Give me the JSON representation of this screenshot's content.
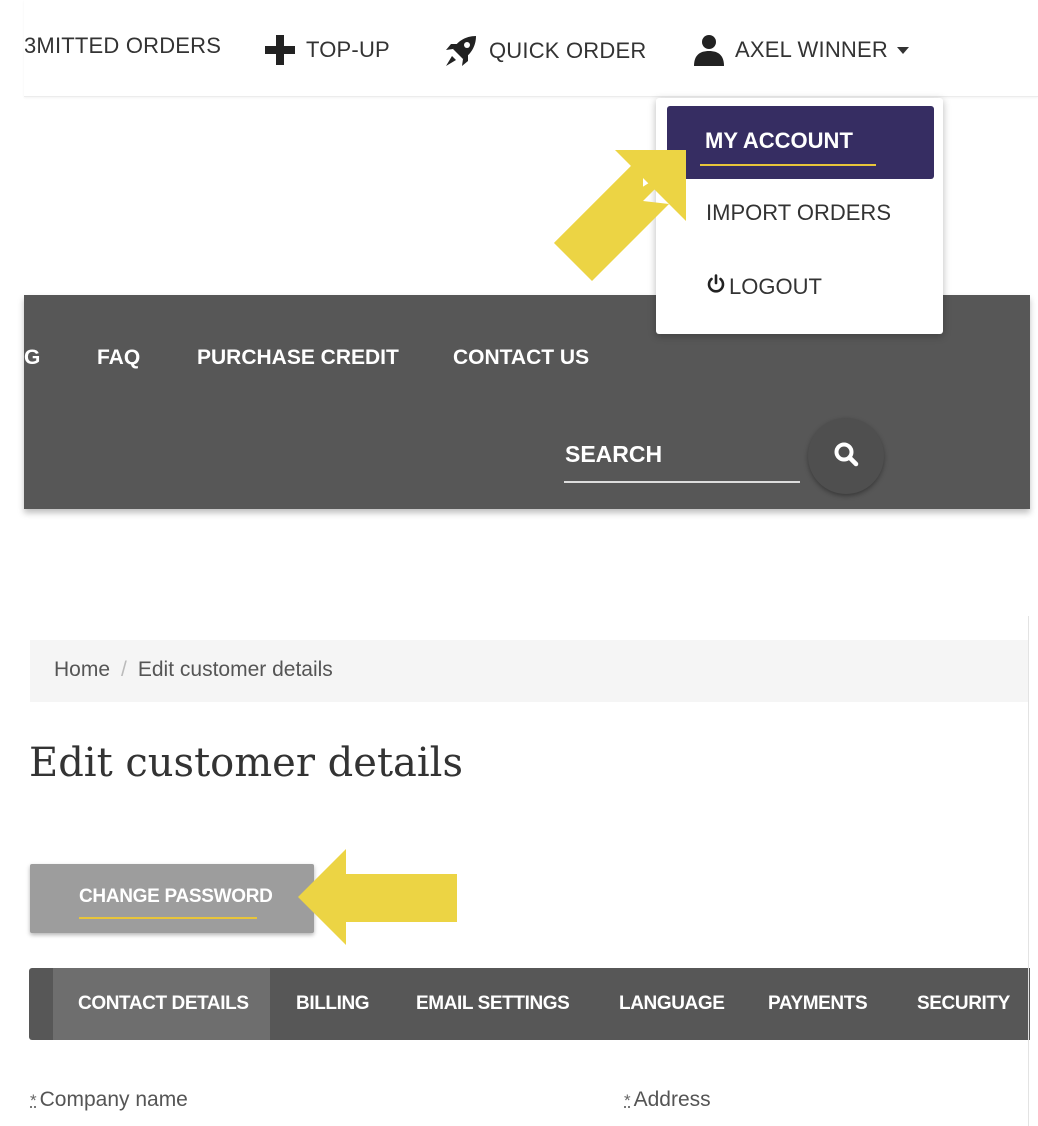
{
  "topbar": {
    "submitted_orders": "3MITTED ORDERS",
    "topup": "TOP-UP",
    "quick_order": "QUICK ORDER",
    "user_name": "AXEL WINNER"
  },
  "user_menu": {
    "my_account": "MY ACCOUNT",
    "import_orders": "IMPORT ORDERS",
    "logout": "LOGOUT"
  },
  "main_nav": {
    "partial_item": "G",
    "faq": "FAQ",
    "purchase_credit": "PURCHASE CREDIT",
    "contact_us": "CONTACT US"
  },
  "search": {
    "label": "SEARCH"
  },
  "breadcrumb": {
    "home": "Home",
    "separator": "/",
    "current": "Edit customer details"
  },
  "page": {
    "title": "Edit customer details",
    "change_password": "CHANGE PASSWORD"
  },
  "tabs": [
    {
      "label": "CONTACT DETAILS",
      "active": true
    },
    {
      "label": "BILLING",
      "active": false
    },
    {
      "label": "EMAIL SETTINGS",
      "active": false
    },
    {
      "label": "LANGUAGE",
      "active": false
    },
    {
      "label": "PAYMENTS",
      "active": false
    },
    {
      "label": "SECURITY",
      "active": false
    }
  ],
  "fields": {
    "required_marker": "*",
    "company_name": "Company name",
    "address": "Address"
  },
  "icons": {
    "topup": "plus-icon",
    "quick_order": "rocket-icon",
    "user": "user-icon",
    "caret": "caret-down-icon",
    "logout": "power-icon",
    "search": "search-icon",
    "annotation": "arrow-annotation"
  },
  "colors": {
    "menu_active_bg": "#362d62",
    "accent_yellow": "#e8c53a",
    "dark_band": "#575757",
    "tab_active_bg": "#6e6e6e",
    "button_grey": "#9d9d9d",
    "annotation_arrow": "#ecd444"
  }
}
